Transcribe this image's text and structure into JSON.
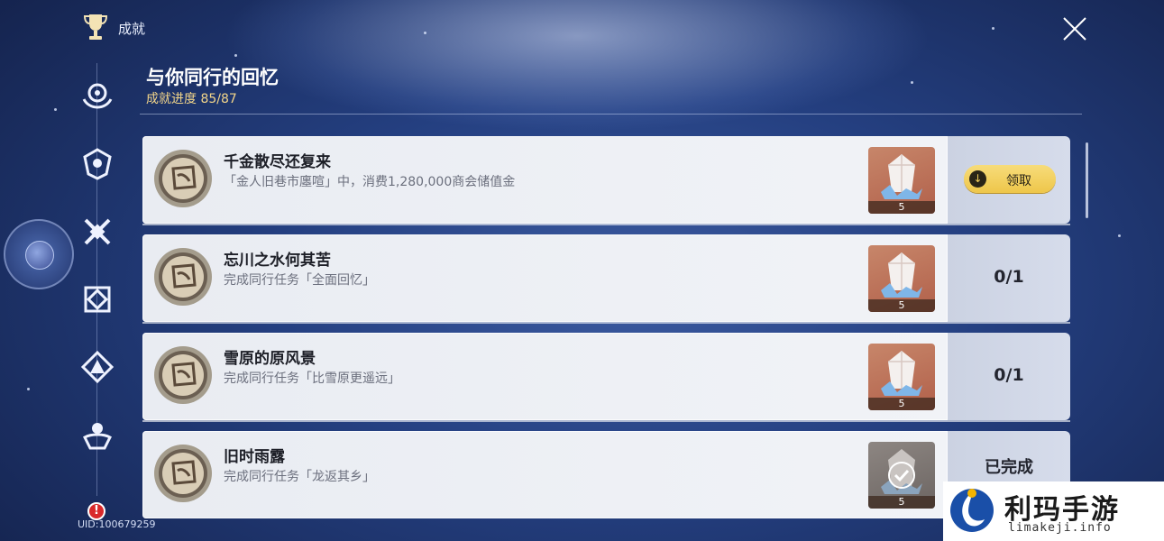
{
  "header": {
    "app_title": "成就",
    "page_title": "与你同行的回忆",
    "progress": "成就进度 85/87"
  },
  "achievements": [
    {
      "title": "千金散尽还复来",
      "desc": "「金人旧巷市廛喧」中，消费1,280,000商会储值金",
      "reward_qty": "5",
      "action": "领取",
      "state": "claimable"
    },
    {
      "title": "忘川之水何其苦",
      "desc": "完成同行任务「全面回忆」",
      "reward_qty": "5",
      "progress": "0/1",
      "state": "in-progress"
    },
    {
      "title": "雪原的原风景",
      "desc": "完成同行任务「比雪原更遥远」",
      "reward_qty": "5",
      "progress": "0/1",
      "state": "in-progress"
    },
    {
      "title": "旧时雨露",
      "desc": "完成同行任务「龙返其乡」",
      "reward_qty": "5",
      "status": "已完成",
      "state": "completed"
    }
  ],
  "user": {
    "uid": "UID:100679259"
  },
  "alert": {
    "symbol": "!"
  },
  "watermark": {
    "name": "利玛手游",
    "site": "limakeji.info"
  },
  "colors": {
    "accent_gold": "#eec64a",
    "progress_text": "#f2d58a",
    "card_bg": "#eef0f5"
  },
  "icons": {
    "top": "trophy-icon",
    "close": "close-icon",
    "rail": [
      "category-emblem-1-icon",
      "category-emblem-2-icon",
      "category-emblem-3-icon",
      "category-emblem-4-icon",
      "category-emblem-5-icon",
      "category-emblem-6-icon"
    ],
    "reward": "crystal-icon"
  }
}
